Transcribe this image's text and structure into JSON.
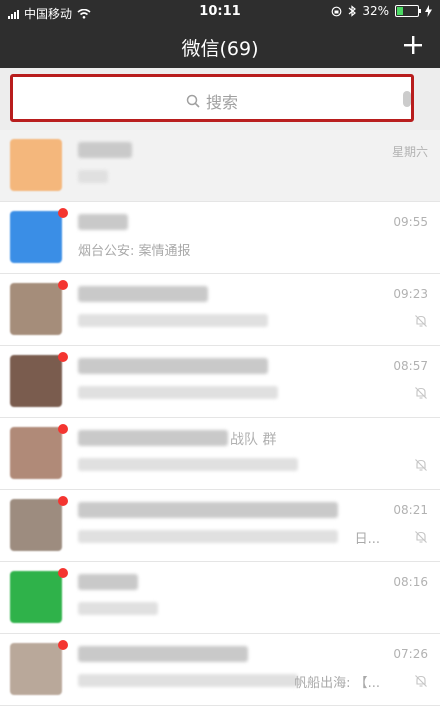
{
  "status_bar": {
    "carrier": "中国移动",
    "time": "10:11",
    "battery_percent": "32%",
    "battery_level": 0.32
  },
  "nav": {
    "title": "微信(69)"
  },
  "search": {
    "placeholder": "搜索"
  },
  "colors": {
    "bar": "#2e2e2e",
    "badge": "#f43530",
    "highlight": "#b81d1d"
  },
  "chats": [
    {
      "time": "星期六",
      "name_visible": "",
      "preview_visible": "",
      "muted": false,
      "avatar_color": "#f4b77c"
    },
    {
      "time": "09:55",
      "name_visible": "",
      "preview_visible": "烟台公安: 案情通报",
      "muted": false,
      "avatar_color": "#3a8ee6"
    },
    {
      "time": "09:23",
      "name_visible": "",
      "preview_visible": "",
      "muted": true,
      "avatar_color": "#a58d7a"
    },
    {
      "time": "08:57",
      "name_visible": "",
      "preview_visible": "",
      "muted": true,
      "avatar_color": "#7a5c4e"
    },
    {
      "time": "",
      "name_visible": "战队 群",
      "preview_visible": "",
      "muted": true,
      "avatar_color": "#b08a78"
    },
    {
      "time": "08:21",
      "name_visible": "",
      "preview_visible": "日...",
      "muted": true,
      "avatar_color": "#9d8c7f"
    },
    {
      "time": "08:16",
      "name_visible": "",
      "preview_visible": "",
      "muted": false,
      "avatar_color": "#2fb24a"
    },
    {
      "time": "07:26",
      "name_visible": "",
      "preview_visible": "帆船出海: 【...",
      "muted": true,
      "avatar_color": "#b9a89a"
    }
  ]
}
